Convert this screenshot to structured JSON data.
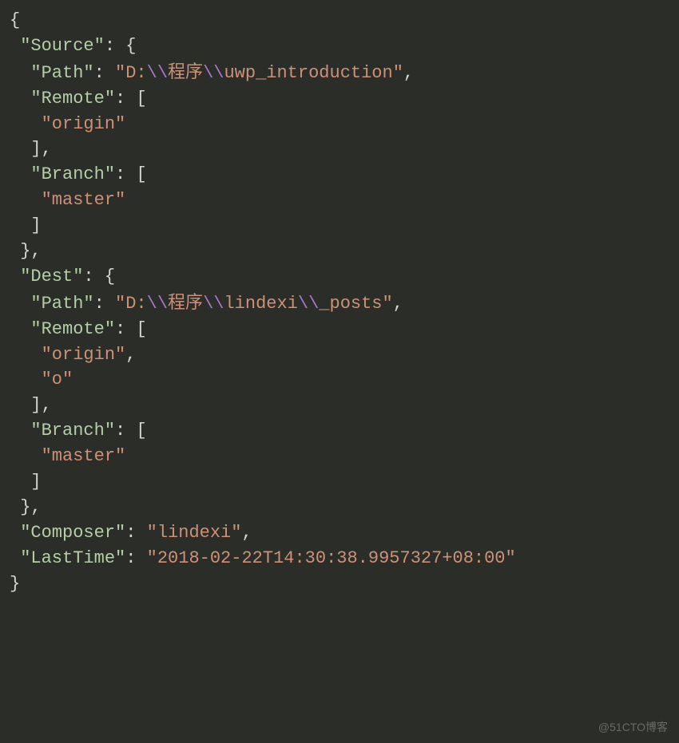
{
  "code": {
    "lines": [
      {
        "indent": 0,
        "segments": [
          {
            "type": "brace",
            "text": "{"
          }
        ]
      },
      {
        "indent": 1,
        "segments": [
          {
            "type": "key",
            "text": "\"Source\""
          },
          {
            "type": "punct",
            "text": ": "
          },
          {
            "type": "brace",
            "text": "{"
          }
        ]
      },
      {
        "indent": 2,
        "segments": [
          {
            "type": "key",
            "text": "\"Path\""
          },
          {
            "type": "punct",
            "text": ": "
          },
          {
            "type": "string",
            "text": "\"D:"
          },
          {
            "type": "escape",
            "text": "\\\\"
          },
          {
            "type": "string-cjk",
            "text": "程序"
          },
          {
            "type": "escape",
            "text": "\\\\"
          },
          {
            "type": "string",
            "text": "uwp_introduction\""
          },
          {
            "type": "punct",
            "text": ","
          }
        ]
      },
      {
        "indent": 2,
        "segments": [
          {
            "type": "key",
            "text": "\"Remote\""
          },
          {
            "type": "punct",
            "text": ": "
          },
          {
            "type": "bracket",
            "text": "["
          }
        ]
      },
      {
        "indent": 3,
        "segments": [
          {
            "type": "string",
            "text": "\"origin\""
          }
        ]
      },
      {
        "indent": 2,
        "segments": [
          {
            "type": "bracket",
            "text": "]"
          },
          {
            "type": "punct",
            "text": ","
          }
        ]
      },
      {
        "indent": 2,
        "segments": [
          {
            "type": "key",
            "text": "\"Branch\""
          },
          {
            "type": "punct",
            "text": ": "
          },
          {
            "type": "bracket",
            "text": "["
          }
        ]
      },
      {
        "indent": 3,
        "segments": [
          {
            "type": "string",
            "text": "\"master\""
          }
        ]
      },
      {
        "indent": 2,
        "segments": [
          {
            "type": "bracket",
            "text": "]"
          }
        ]
      },
      {
        "indent": 1,
        "segments": [
          {
            "type": "brace",
            "text": "}"
          },
          {
            "type": "punct",
            "text": ","
          }
        ]
      },
      {
        "indent": 1,
        "segments": [
          {
            "type": "key",
            "text": "\"Dest\""
          },
          {
            "type": "punct",
            "text": ": "
          },
          {
            "type": "brace",
            "text": "{"
          }
        ]
      },
      {
        "indent": 2,
        "segments": [
          {
            "type": "key",
            "text": "\"Path\""
          },
          {
            "type": "punct",
            "text": ": "
          },
          {
            "type": "string",
            "text": "\"D:"
          },
          {
            "type": "escape",
            "text": "\\\\"
          },
          {
            "type": "string-cjk",
            "text": "程序"
          },
          {
            "type": "escape",
            "text": "\\\\"
          },
          {
            "type": "string",
            "text": "lindexi"
          },
          {
            "type": "escape",
            "text": "\\\\"
          },
          {
            "type": "string",
            "text": "_posts\""
          },
          {
            "type": "punct",
            "text": ","
          }
        ]
      },
      {
        "indent": 2,
        "segments": [
          {
            "type": "key",
            "text": "\"Remote\""
          },
          {
            "type": "punct",
            "text": ": "
          },
          {
            "type": "bracket",
            "text": "["
          }
        ]
      },
      {
        "indent": 3,
        "segments": [
          {
            "type": "string",
            "text": "\"origin\""
          },
          {
            "type": "punct",
            "text": ","
          }
        ]
      },
      {
        "indent": 3,
        "segments": [
          {
            "type": "string",
            "text": "\"o\""
          }
        ]
      },
      {
        "indent": 2,
        "segments": [
          {
            "type": "bracket",
            "text": "]"
          },
          {
            "type": "punct",
            "text": ","
          }
        ]
      },
      {
        "indent": 2,
        "segments": [
          {
            "type": "key",
            "text": "\"Branch\""
          },
          {
            "type": "punct",
            "text": ": "
          },
          {
            "type": "bracket",
            "text": "["
          }
        ]
      },
      {
        "indent": 3,
        "segments": [
          {
            "type": "string",
            "text": "\"master\""
          }
        ]
      },
      {
        "indent": 2,
        "segments": [
          {
            "type": "bracket",
            "text": "]"
          }
        ]
      },
      {
        "indent": 1,
        "segments": [
          {
            "type": "brace",
            "text": "}"
          },
          {
            "type": "punct",
            "text": ","
          }
        ]
      },
      {
        "indent": 1,
        "segments": [
          {
            "type": "key",
            "text": "\"Composer\""
          },
          {
            "type": "punct",
            "text": ": "
          },
          {
            "type": "string",
            "text": "\"lindexi\""
          },
          {
            "type": "punct",
            "text": ","
          }
        ]
      },
      {
        "indent": 1,
        "segments": [
          {
            "type": "key",
            "text": "\"LastTime\""
          },
          {
            "type": "punct",
            "text": ": "
          },
          {
            "type": "string",
            "text": "\"2018-02-22T14:30:38.9957327+08:00\""
          }
        ]
      },
      {
        "indent": 0,
        "segments": [
          {
            "type": "brace",
            "text": "}"
          }
        ]
      }
    ]
  },
  "json_values": {
    "Source": {
      "Path": "D:\\\\程序\\\\uwp_introduction",
      "Remote": [
        "origin"
      ],
      "Branch": [
        "master"
      ]
    },
    "Dest": {
      "Path": "D:\\\\程序\\\\lindexi\\\\_posts",
      "Remote": [
        "origin",
        "o"
      ],
      "Branch": [
        "master"
      ]
    },
    "Composer": "lindexi",
    "LastTime": "2018-02-22T14:30:38.9957327+08:00"
  },
  "watermark": "@51CTO博客"
}
